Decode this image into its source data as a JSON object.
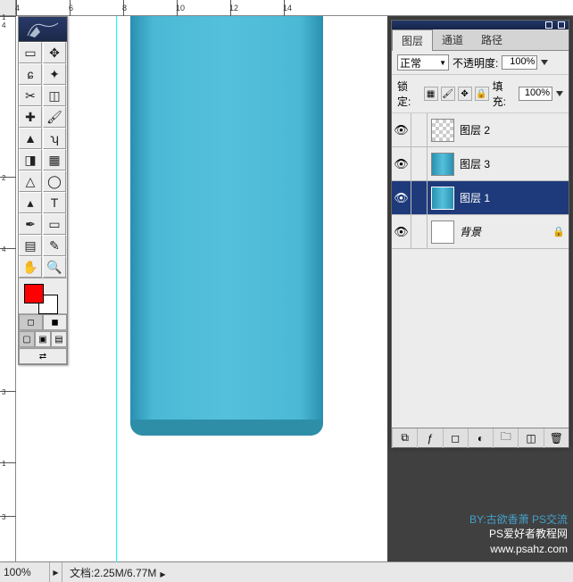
{
  "ruler": {
    "h": [
      "4",
      "6",
      "8",
      "10",
      "12",
      "14"
    ],
    "v": [
      "1",
      "4",
      "2",
      "4",
      "3",
      "1",
      "3"
    ]
  },
  "panel": {
    "tabs": {
      "layers": "图层",
      "channels": "通道",
      "paths": "路径"
    },
    "blend_mode": "正常",
    "opacity_label": "不透明度:",
    "opacity_value": "100%",
    "lock_label": "锁定:",
    "fill_label": "填充:",
    "fill_value": "100%"
  },
  "layers": [
    {
      "name": "图层 2",
      "thumb": "checker",
      "selected": false,
      "locked": false
    },
    {
      "name": "图层 3",
      "thumb": "cyl",
      "selected": false,
      "locked": false
    },
    {
      "name": "图层 1",
      "thumb": "cyl",
      "selected": true,
      "locked": false
    },
    {
      "name": "背景",
      "thumb": "white",
      "selected": false,
      "locked": true,
      "italic": true
    }
  ],
  "status": {
    "zoom": "100%",
    "doc_label": "文档:",
    "doc_value": "2.25M/6.77M"
  },
  "watermark": {
    "line1": "BY:古欲香萧 PS交流",
    "line2": "PS爱好者教程网",
    "line3": "www.psahz.com"
  },
  "swatch": {
    "fg": "#ff0000",
    "bg": "#ffffff"
  }
}
